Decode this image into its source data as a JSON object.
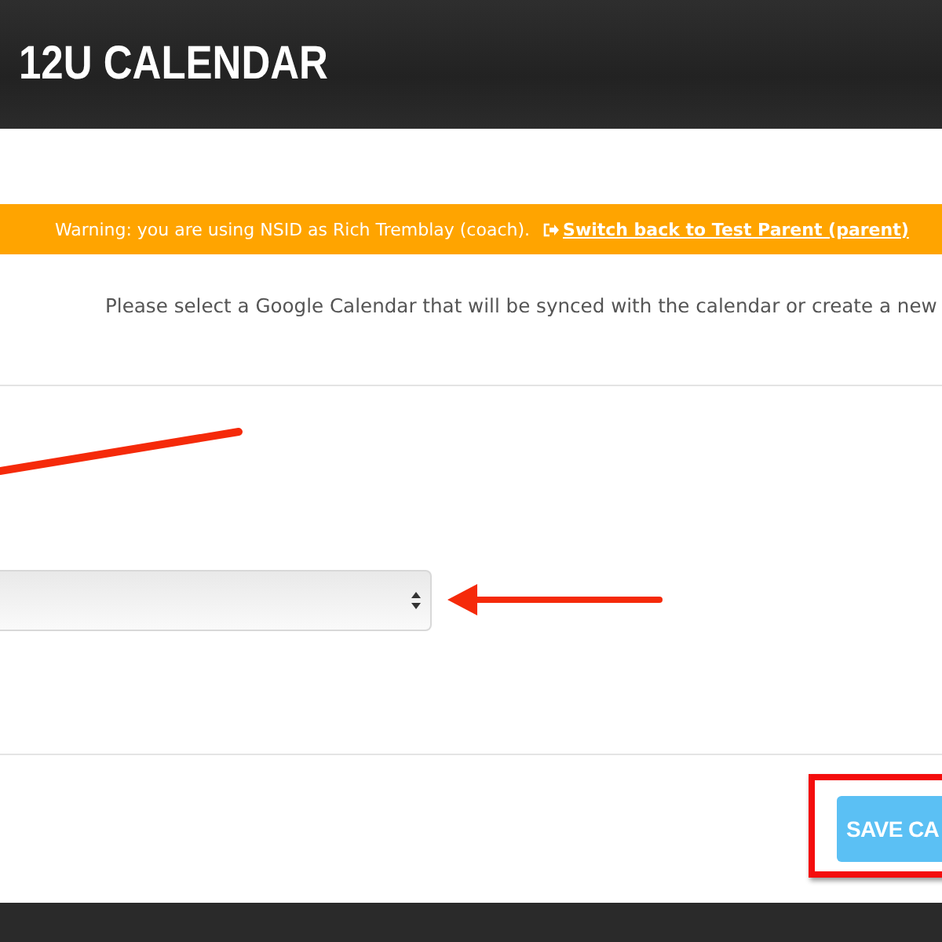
{
  "header": {
    "title": "12U CALENDAR"
  },
  "warning": {
    "text": "Warning: you are using NSID as Rich Tremblay (coach).",
    "link": "Switch back to Test Parent (parent)"
  },
  "instruction": "Please select a Google Calendar that will be synced with the calendar or create a new",
  "calendar_select": {
    "kind": "dropdown"
  },
  "save_button": {
    "label": "SAVE CA"
  }
}
